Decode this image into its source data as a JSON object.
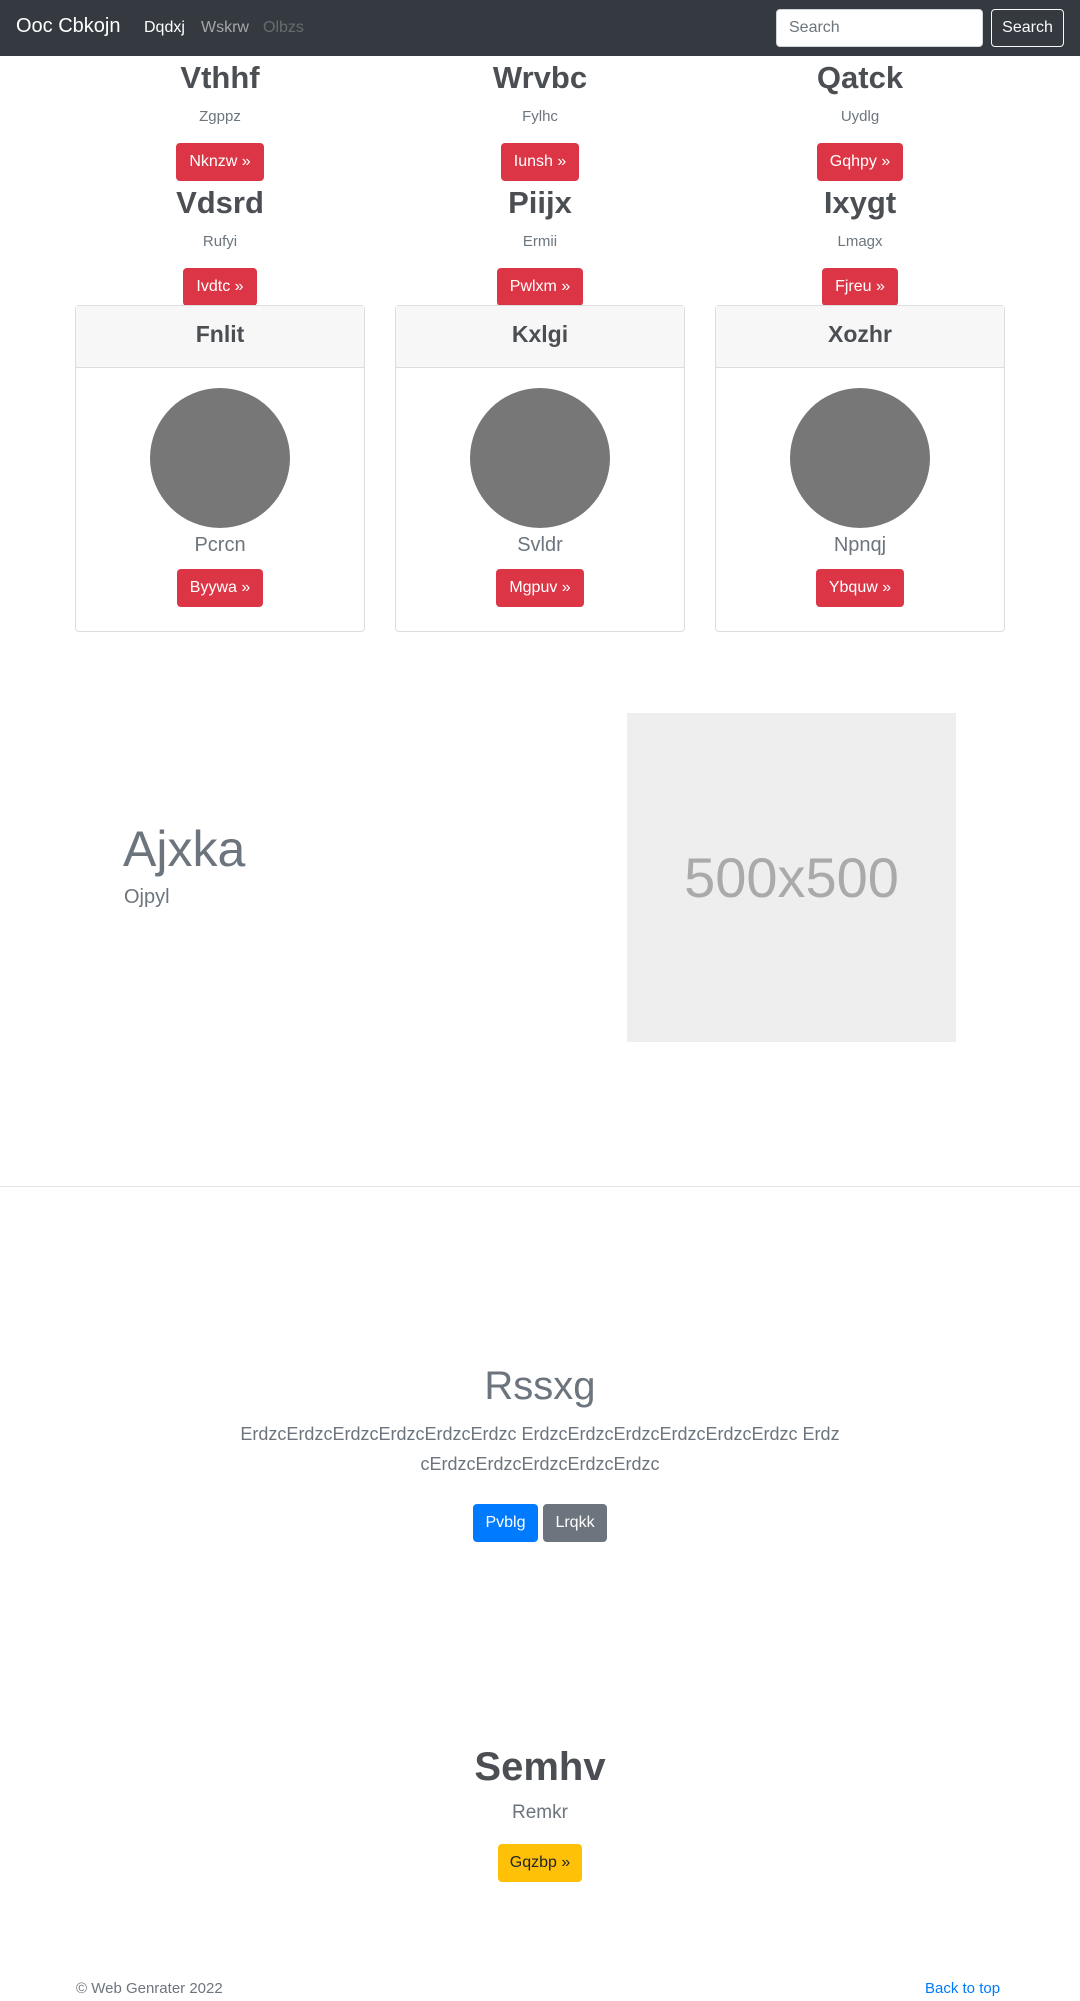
{
  "navbar": {
    "brand": "Ooc Cbkojn",
    "links": [
      "Dqdxj",
      "Wskrw",
      "Olbzs"
    ],
    "search_placeholder": "Search",
    "search_button": "Search"
  },
  "features": [
    {
      "title": "Vthhf",
      "subtitle": "Zgppz",
      "button": "Nknzw »"
    },
    {
      "title": "Wrvbc",
      "subtitle": "Fylhc",
      "button": "Iunsh »"
    },
    {
      "title": "Qatck",
      "subtitle": "Uydlg",
      "button": "Gqhpy »"
    },
    {
      "title": "Vdsrd",
      "subtitle": "Rufyi",
      "button": "Ivdtc »"
    },
    {
      "title": "Piijx",
      "subtitle": "Ermii",
      "button": "Pwlxm »"
    },
    {
      "title": "Ixygt",
      "subtitle": "Lmagx",
      "button": "Fjreu »"
    }
  ],
  "cards": [
    {
      "header": "Fnlit",
      "name": "Pcrcn",
      "button": "Byywa »"
    },
    {
      "header": "Kxlgi",
      "name": "Svldr",
      "button": "Mgpuv »"
    },
    {
      "header": "Xozhr",
      "name": "Npnqj",
      "button": "Ybquw »"
    }
  ],
  "featurette": {
    "title": "Ajxka",
    "subtitle": "Ojpyl",
    "image_label": "500x500"
  },
  "jumbotron": {
    "title": "Rssxg",
    "lead": "ErdzcErdzcErdzcErdzcErdzcErdzc ErdzcErdzcErdzcErdzcErdzcErdzc ErdzcErdzcErdzcErdzcErdzcErdzc",
    "primary_button": "Pvblg",
    "secondary_button": "Lrqkk"
  },
  "section2": {
    "title": "Semhv",
    "subtitle": "Remkr",
    "button": "Gqzbp »"
  },
  "footer": {
    "copyright": "© Web Genrater 2022",
    "back_to_top": "Back to top"
  }
}
